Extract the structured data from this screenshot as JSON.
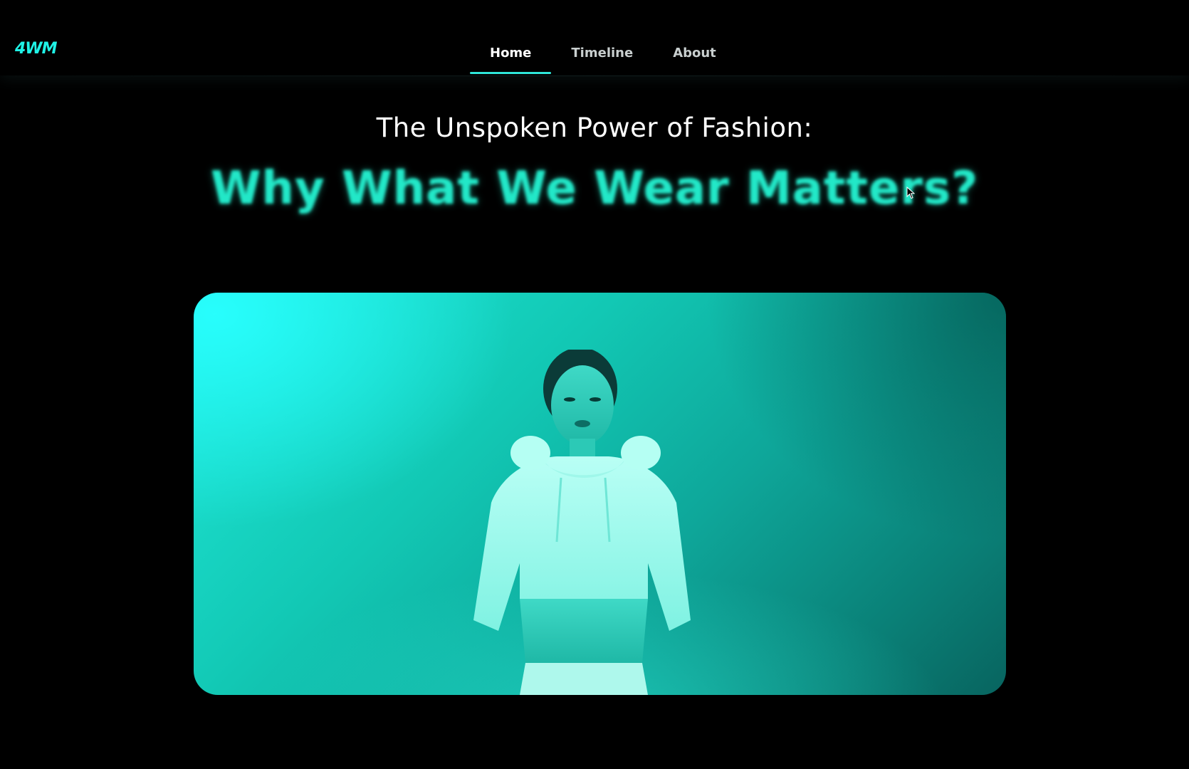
{
  "header": {
    "logo": "4WM",
    "nav": [
      {
        "label": "Home",
        "active": true
      },
      {
        "label": "Timeline",
        "active": false
      },
      {
        "label": "About",
        "active": false
      }
    ]
  },
  "hero": {
    "subtitle": "The Unspoken Power of Fashion:",
    "title": "Why What We Wear Matters?",
    "image_alt": "model in cropped hoodie with teal tint"
  },
  "colors": {
    "background": "#000000",
    "accent": "#2fe6d9",
    "title": "#22e8c8"
  }
}
